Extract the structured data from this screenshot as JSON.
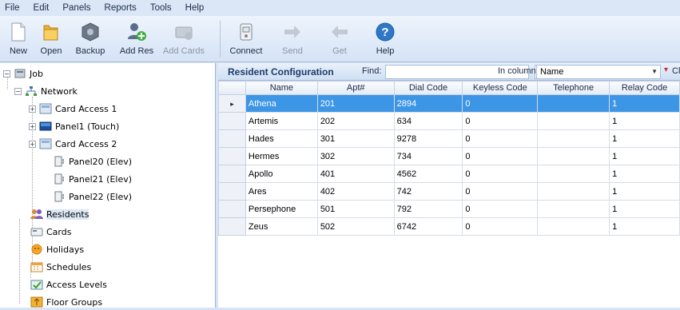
{
  "menu": [
    "File",
    "Edit",
    "Panels",
    "Reports",
    "Tools",
    "Help"
  ],
  "toolbar": {
    "new": "New",
    "open": "Open",
    "backup": "Backup",
    "add_res": "Add Res",
    "add_cards": "Add Cards",
    "connect": "Connect",
    "send": "Send",
    "get": "Get",
    "help": "Help"
  },
  "tree": {
    "job": "Job",
    "network": "Network",
    "card_access_1": "Card Access 1",
    "panel1_touch": "Panel1 (Touch)",
    "card_access_2": "Card Access 2",
    "panel20": "Panel20 (Elev)",
    "panel21": "Panel21 (Elev)",
    "panel22": "Panel22 (Elev)",
    "residents": "Residents",
    "cards": "Cards",
    "holidays": "Holidays",
    "schedules": "Schedules",
    "access_levels": "Access Levels",
    "floor_groups": "Floor Groups",
    "expand_plus": "+",
    "collapse_minus": "−"
  },
  "resident_config": {
    "title": "Resident Configuration",
    "find_label": "Find:",
    "find_value": "",
    "in_column_label": "In column",
    "column_value": "Name",
    "clear_label": "Clear",
    "row_indicator": "▸",
    "columns": [
      "Name",
      "Apt#",
      "Dial Code",
      "Keyless Code",
      "Telephone",
      "Relay Code"
    ],
    "rows": [
      [
        "Athena",
        "201",
        "2894",
        "0",
        "",
        "1"
      ],
      [
        "Artemis",
        "202",
        "634",
        "0",
        "",
        "1"
      ],
      [
        "Hades",
        "301",
        "9278",
        "0",
        "",
        "1"
      ],
      [
        "Hermes",
        "302",
        "734",
        "0",
        "",
        "1"
      ],
      [
        "Apollo",
        "401",
        "4562",
        "0",
        "",
        "1"
      ],
      [
        "Ares",
        "402",
        "742",
        "0",
        "",
        "1"
      ],
      [
        "Persephone",
        "501",
        "792",
        "0",
        "",
        "1"
      ],
      [
        "Zeus",
        "502",
        "6742",
        "0",
        "",
        "1"
      ]
    ],
    "selected_row": 0
  },
  "colors": {
    "selection": "#3d95e6",
    "header_text": "#1d3b6a"
  }
}
